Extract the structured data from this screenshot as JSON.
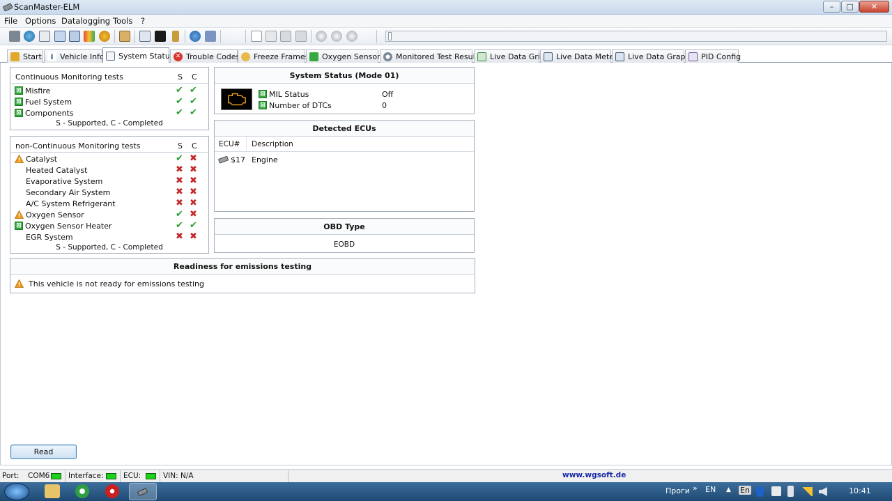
{
  "window": {
    "title": "ScanMaster-ELM",
    "minimize": "–",
    "maximize": "□",
    "close": "✕"
  },
  "menu": [
    "File",
    "Options",
    "Datalogging",
    "Tools",
    "?"
  ],
  "tabs": [
    {
      "label": "Start",
      "icon": "house-icon"
    },
    {
      "label": "Vehicle Info",
      "icon": "info-icon"
    },
    {
      "label": "System Status",
      "icon": "chart-icon"
    },
    {
      "label": "Trouble Codes",
      "icon": "error-icon"
    },
    {
      "label": "Freeze Frames",
      "icon": "engine-icon"
    },
    {
      "label": "Oxygen Sensors",
      "icon": "sensor-icon"
    },
    {
      "label": "Monitored Test Results",
      "icon": "gear-icon"
    },
    {
      "label": "Live Data Grid",
      "icon": "grid-icon"
    },
    {
      "label": "Live Data Meter",
      "icon": "meter-icon"
    },
    {
      "label": "Live Data Graph",
      "icon": "graph-icon"
    },
    {
      "label": "PID Config",
      "icon": "config-icon"
    }
  ],
  "continuous": {
    "title": "Continuous Monitoring tests",
    "col_s": "S",
    "col_c": "C",
    "rows": [
      {
        "name": "Misfire",
        "s": true,
        "c": true,
        "status": "ok"
      },
      {
        "name": "Fuel System",
        "s": true,
        "c": true,
        "status": "ok"
      },
      {
        "name": "Components",
        "s": true,
        "c": true,
        "status": "ok"
      }
    ],
    "footer": "S - Supported, C - Completed"
  },
  "noncontinuous": {
    "title": "non-Continuous Monitoring tests",
    "col_s": "S",
    "col_c": "C",
    "rows": [
      {
        "name": "Catalyst",
        "s": true,
        "c": false,
        "status": "warn"
      },
      {
        "name": "Heated Catalyst",
        "s": false,
        "c": false,
        "status": "none"
      },
      {
        "name": "Evaporative System",
        "s": false,
        "c": false,
        "status": "none"
      },
      {
        "name": "Secondary Air System",
        "s": false,
        "c": false,
        "status": "none"
      },
      {
        "name": "A/C System Refrigerant",
        "s": false,
        "c": false,
        "status": "none"
      },
      {
        "name": "Oxygen Sensor",
        "s": true,
        "c": false,
        "status": "warn"
      },
      {
        "name": "Oxygen Sensor Heater",
        "s": true,
        "c": true,
        "status": "ok"
      },
      {
        "name": "EGR System",
        "s": false,
        "c": false,
        "status": "none"
      }
    ],
    "footer": "S - Supported, C - Completed"
  },
  "system_status": {
    "title": "System Status (Mode 01)",
    "rows": [
      {
        "label": "MIL Status",
        "value": "Off"
      },
      {
        "label": "Number of DTCs",
        "value": "0"
      }
    ]
  },
  "ecus": {
    "title": "Detected ECUs",
    "col_ecu": "ECU#",
    "col_desc": "Description",
    "rows": [
      {
        "ecu": "$17",
        "desc": "Engine"
      }
    ]
  },
  "obd": {
    "title": "OBD Type",
    "value": "EOBD"
  },
  "readiness": {
    "title": "Readiness for emissions testing",
    "message": "This vehicle is not ready for emissions testing"
  },
  "read_button": "Read",
  "statusbar": {
    "port_label": "Port:",
    "port_value": "COM6",
    "interface_label": "Interface:",
    "ecu_label": "ECU:",
    "vin": "VIN: N/A",
    "link": "www.wgsoft.de"
  },
  "taskbar": {
    "programs": "Проги",
    "chevron": "»",
    "lang": "EN",
    "kb": "En",
    "clock": "10:41"
  },
  "colors": {
    "accent": "#2f6db5",
    "ok": "#2d9d2f",
    "fail": "#c0292b",
    "warn": "#f0a020",
    "led": "#1bd21b"
  }
}
